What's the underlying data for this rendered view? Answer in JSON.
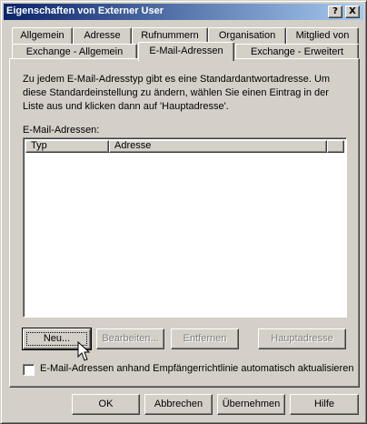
{
  "window": {
    "title": "Eigenschaften von Externer User",
    "help_button": "?",
    "close_button": "X"
  },
  "tabs": {
    "row1": [
      "Allgemein",
      "Adresse",
      "Rufnummern",
      "Organisation",
      "Mitglied von"
    ],
    "row2": [
      "Exchange - Allgemein",
      "E-Mail-Adressen",
      "Exchange - Erweitert"
    ],
    "active": "E-Mail-Adressen"
  },
  "panel": {
    "description": "Zu jedem E-Mail-Adresstyp gibt es eine Standardantwortadresse. Um diese Standardeinstellung zu ändern, wählen Sie einen Eintrag in der Liste aus und klicken dann auf 'Hauptadresse'.",
    "list_label": "E-Mail-Adressen:",
    "columns": [
      "Typ",
      "Adresse"
    ],
    "rows": [],
    "buttons": {
      "new": "Neu...",
      "edit": "Bearbeiten...",
      "remove": "Entfernen",
      "primary": "Hauptadresse"
    },
    "auto_update_checkbox": {
      "label": "E-Mail-Adressen anhand Empfängerrichtlinie automatisch aktualisieren",
      "checked": false
    }
  },
  "footer": {
    "ok": "OK",
    "cancel": "Abbrechen",
    "apply": "Übernehmen",
    "help": "Hilfe"
  },
  "colors": {
    "face": "#d4d0c8",
    "title_start": "#0a246a",
    "title_end": "#a6caf0",
    "disabled_text": "#808080"
  }
}
